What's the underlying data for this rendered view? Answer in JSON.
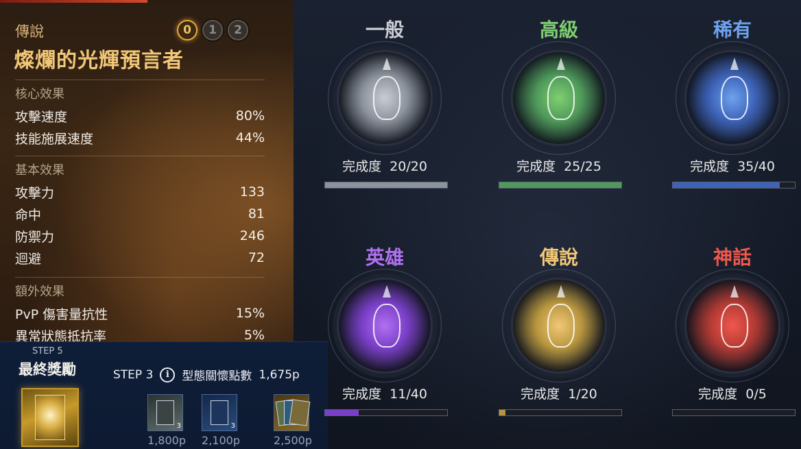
{
  "left": {
    "grade_label": "傳說",
    "title": "燦爛的光輝預言者",
    "steps": [
      "0",
      "1",
      "2"
    ],
    "core": {
      "header": "核心效果",
      "items": [
        {
          "label": "攻擊速度",
          "value": "80%"
        },
        {
          "label": "技能施展速度",
          "value": "44%"
        }
      ]
    },
    "basic": {
      "header": "基本效果",
      "items": [
        {
          "label": "攻擊力",
          "value": "133"
        },
        {
          "label": "命中",
          "value": "81"
        },
        {
          "label": "防禦力",
          "value": "246"
        },
        {
          "label": "迴避",
          "value": "72"
        }
      ]
    },
    "extra": {
      "header": "額外效果",
      "items": [
        {
          "label": "PvP 傷害量抗性",
          "value": "15%"
        },
        {
          "label": "異常狀態抵抗率",
          "value": "5%"
        }
      ]
    }
  },
  "reward": {
    "step5": "STEP 5",
    "final_label": "最終獎勵",
    "step3": "STEP 3",
    "info_icon": "i",
    "points_label": "型態關懷點數",
    "points_value": "1,675p",
    "items": [
      {
        "count": "3",
        "price": "1,800p",
        "color": "#5f6b6a"
      },
      {
        "count": "3",
        "price": "2,100p",
        "color": "#2a4b7a"
      },
      {
        "count": "",
        "price": "2,500p",
        "color": "#8a6a22"
      }
    ]
  },
  "grades": [
    {
      "name": "一般",
      "completion_label": "完成度",
      "completion": "20/20",
      "progress": 1.0,
      "color": "#c9ccd2",
      "glow": "#8d939d"
    },
    {
      "name": "高級",
      "completion_label": "完成度",
      "completion": "25/25",
      "progress": 1.0,
      "color": "#7fcf6f",
      "glow": "#4f9a5a"
    },
    {
      "name": "稀有",
      "completion_label": "完成度",
      "completion": "35/40",
      "progress": 0.875,
      "color": "#6ea2ee",
      "glow": "#3d63b8"
    },
    {
      "name": "英雄",
      "completion_label": "完成度",
      "completion": "11/40",
      "progress": 0.275,
      "color": "#b071f0",
      "glow": "#7a3fc8"
    },
    {
      "name": "傳說",
      "completion_label": "完成度",
      "completion": "1/20",
      "progress": 0.05,
      "color": "#f1c777",
      "glow": "#b8963e"
    },
    {
      "name": "神話",
      "completion_label": "完成度",
      "completion": "0/5",
      "progress": 0.0,
      "color": "#f0584d",
      "glow": "#b23a33"
    }
  ]
}
